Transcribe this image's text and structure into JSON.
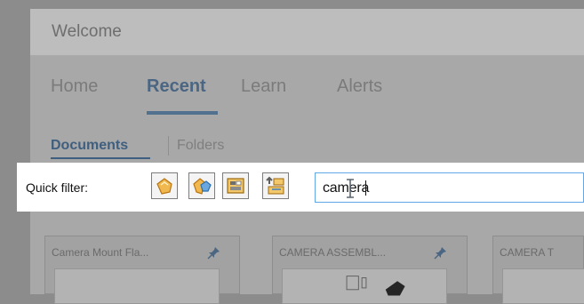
{
  "window": {
    "title": "Welcome"
  },
  "nav": {
    "tabs": [
      {
        "label": "Home",
        "active": false
      },
      {
        "label": "Recent",
        "active": true
      },
      {
        "label": "Learn",
        "active": false
      },
      {
        "label": "Alerts",
        "active": false
      }
    ]
  },
  "subnav": {
    "tabs": [
      {
        "label": "Documents",
        "active": true
      },
      {
        "label": "Folders",
        "active": false
      }
    ]
  },
  "filter": {
    "label": "Quick filter:",
    "buttons": [
      {
        "icon": "part-filter-icon"
      },
      {
        "icon": "assembly-filter-icon"
      },
      {
        "icon": "drawing-filter-icon"
      },
      {
        "icon": "top-level-assembly-filter-icon"
      }
    ],
    "search": {
      "value": "camera"
    }
  },
  "cards": [
    {
      "label": "Camera Mount Fla..."
    },
    {
      "label": "CAMERA ASSEMBL..."
    },
    {
      "label": "CAMERA T"
    }
  ],
  "colors": {
    "active_tab": "#4a6683",
    "search_border": "#62a8e6",
    "filter_bar": "#ffffff"
  }
}
